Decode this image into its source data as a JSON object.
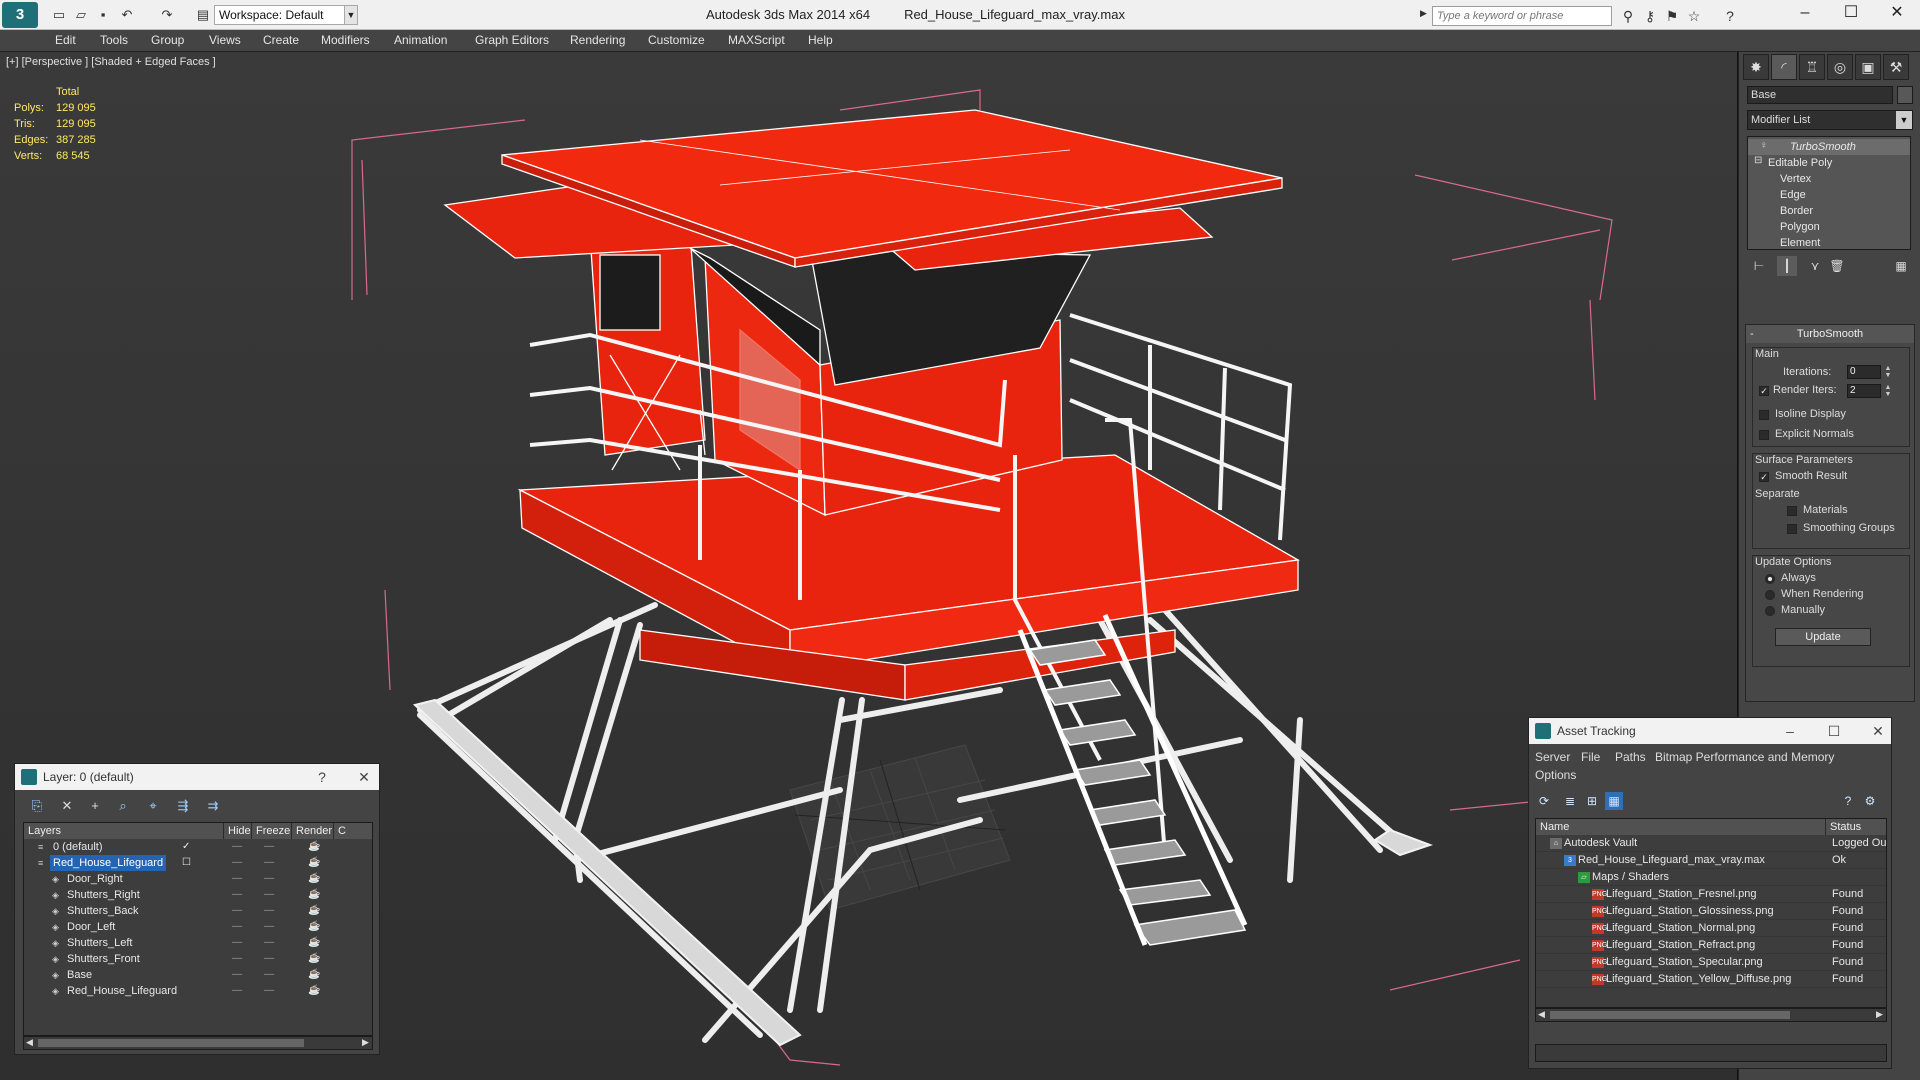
{
  "titlebar": {
    "workspace": "Workspace: Default",
    "app_name": "Autodesk 3ds Max  2014 x64",
    "file_name": "Red_House_Lifeguard_max_vray.max",
    "search_placeholder": "Type a keyword or phrase"
  },
  "menu": [
    "Edit",
    "Tools",
    "Group",
    "Views",
    "Create",
    "Modifiers",
    "Animation",
    "Graph Editors",
    "Rendering",
    "Customize",
    "MAXScript",
    "Help"
  ],
  "viewport": {
    "label": "[+] [Perspective ] [Shaded + Edged Faces ]",
    "stats": {
      "header": "Total",
      "rows": [
        {
          "label": "Polys:",
          "value": "129 095"
        },
        {
          "label": "Tris:",
          "value": "129 095"
        },
        {
          "label": "Edges:",
          "value": "387 285"
        },
        {
          "label": "Verts:",
          "value": "68 545"
        }
      ]
    },
    "colors": {
      "model": "#e8240e",
      "wire": "#f2f2f2",
      "bbox": "#d86a8c"
    }
  },
  "command_panel": {
    "object_name": "Base",
    "modifier_list": "Modifier List",
    "stack": [
      "TurboSmooth",
      "Editable Poly",
      "Vertex",
      "Edge",
      "Border",
      "Polygon",
      "Element"
    ],
    "rollout_title": "TurboSmooth",
    "main_label": "Main",
    "iterations_label": "Iterations:",
    "iterations_value": "0",
    "render_iters_label": "Render Iters:",
    "render_iters_value": "2",
    "isoline_display": "Isoline Display",
    "explicit_normals": "Explicit Normals",
    "surface_params": "Surface Parameters",
    "smooth_result": "Smooth Result",
    "separate_label": "Separate",
    "materials": "Materials",
    "smoothing_groups": "Smoothing Groups",
    "update_options": "Update Options",
    "always": "Always",
    "when_rendering": "When Rendering",
    "manually": "Manually",
    "update_button": "Update"
  },
  "layer_window": {
    "title": "Layer: 0 (default)",
    "columns": [
      "Layers",
      "Hide",
      "Freeze",
      "Render",
      "C"
    ],
    "rows": [
      {
        "name": "0 (default)",
        "indent": 0,
        "selected": false,
        "check": true
      },
      {
        "name": "Red_House_Lifeguard",
        "indent": 0,
        "selected": true,
        "check": false
      },
      {
        "name": "Door_Right",
        "indent": 1,
        "selected": false,
        "check": false
      },
      {
        "name": "Shutters_Right",
        "indent": 1,
        "selected": false,
        "check": false
      },
      {
        "name": "Shutters_Back",
        "indent": 1,
        "selected": false,
        "check": false
      },
      {
        "name": "Door_Left",
        "indent": 1,
        "selected": false,
        "check": false
      },
      {
        "name": "Shutters_Left",
        "indent": 1,
        "selected": false,
        "check": false
      },
      {
        "name": "Shutters_Front",
        "indent": 1,
        "selected": false,
        "check": false
      },
      {
        "name": "Base",
        "indent": 1,
        "selected": false,
        "check": false
      },
      {
        "name": "Red_House_Lifeguard",
        "indent": 1,
        "selected": false,
        "check": false
      }
    ]
  },
  "asset_window": {
    "title": "Asset Tracking",
    "menu": [
      "Server",
      "File",
      "Paths",
      "Bitmap Performance and Memory",
      "Options"
    ],
    "columns": [
      "Name",
      "Status"
    ],
    "rows": [
      {
        "name": "Autodesk Vault",
        "status": "Logged Ou",
        "level": 0,
        "icon": "vault"
      },
      {
        "name": "Red_House_Lifeguard_max_vray.max",
        "status": "Ok",
        "level": 1,
        "icon": "max"
      },
      {
        "name": "Maps / Shaders",
        "status": "",
        "level": 2,
        "icon": "folder"
      },
      {
        "name": "Lifeguard_Station_Fresnel.png",
        "status": "Found",
        "level": 3,
        "icon": "png"
      },
      {
        "name": "Lifeguard_Station_Glossiness.png",
        "status": "Found",
        "level": 3,
        "icon": "png"
      },
      {
        "name": "Lifeguard_Station_Normal.png",
        "status": "Found",
        "level": 3,
        "icon": "png"
      },
      {
        "name": "Lifeguard_Station_Refract.png",
        "status": "Found",
        "level": 3,
        "icon": "png"
      },
      {
        "name": "Lifeguard_Station_Specular.png",
        "status": "Found",
        "level": 3,
        "icon": "png"
      },
      {
        "name": "Lifeguard_Station_Yellow_Diffuse.png",
        "status": "Found",
        "level": 3,
        "icon": "png"
      }
    ]
  }
}
